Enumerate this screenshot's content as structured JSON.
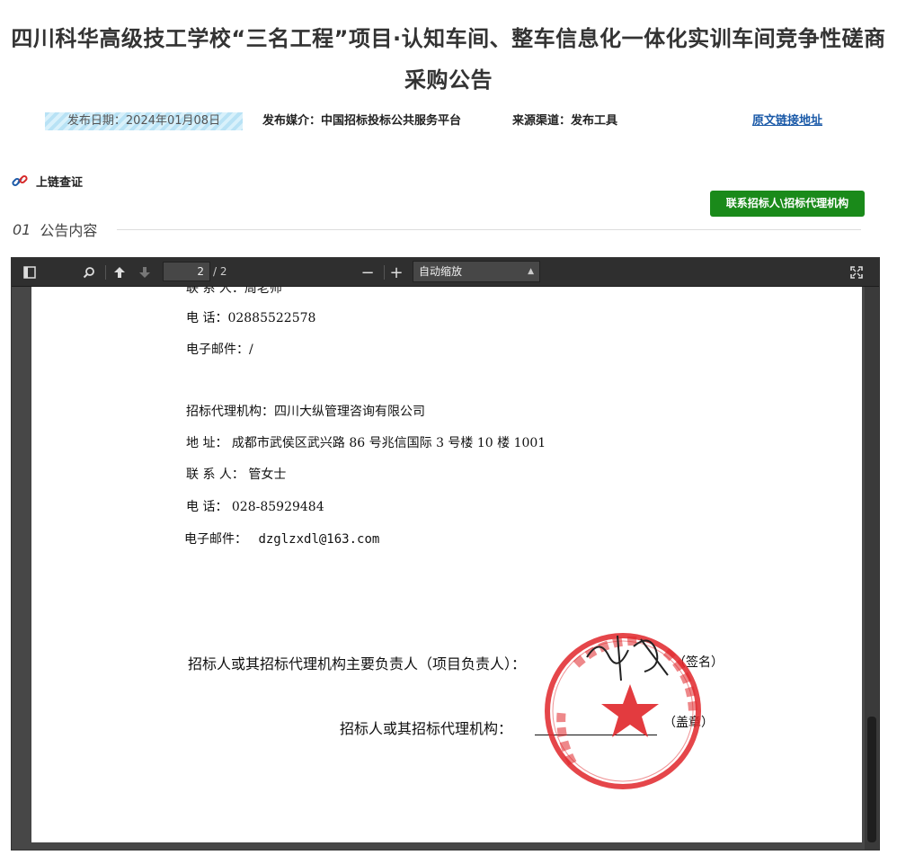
{
  "page": {
    "title_line1": "四川科华高级技工学校“三名工程”项目·认知车间、整车信息化一体化实训车间竞争性磋商",
    "title_line2": "采购公告"
  },
  "meta": {
    "date": "发布日期：2024年01月08日",
    "media": "发布媒介：中国招标投标公共服务平台",
    "source": "来源渠道：发布工具",
    "original_link": "原文链接地址"
  },
  "chain_verify": "上链查证",
  "contact_button": "联系招标人\\招标代理机构",
  "section": {
    "num": "01",
    "label": "公告内容"
  },
  "viewer": {
    "page_value": "2",
    "page_count": "/ 2",
    "zoom_label": "自动缩放",
    "icons": {
      "sidebar": "sidebar-toggle-icon",
      "search": "search-icon",
      "prev": "arrow-up-icon",
      "next": "arrow-down-icon",
      "zoom_out": "minus-icon",
      "zoom_in": "plus-icon",
      "fullscreen": "fullscreen-icon"
    }
  },
  "document": {
    "cut_line": "联 系 人：周老师",
    "tender_phone": "电      话：02885522578",
    "tender_email": "电子邮件：/",
    "agency_name": "招标代理机构：四川大纵管理咨询有限公司",
    "agency_address": "地      址： 成都市武侯区武兴路 86 号兆信国际 3 号楼 10 楼 1001",
    "agency_contact": "联 系 人： 管女士",
    "agency_phone": "电      话： 028-85929484",
    "agency_email_label": "电子邮件：",
    "agency_email": "dzglzxdl@163.com",
    "sign_line1": "招标人或其招标代理机构主要负责人（项目负责人）：",
    "sign_suffix1": "（签名）",
    "sign_line2": "招标人或其招标代理机构：",
    "sign_suffix2": "（盖章）"
  },
  "colors": {
    "link": "#1b5aa8",
    "button_green": "#1a8a1a",
    "seal_red": "#e0262a",
    "toolbar": "#2f2f2f"
  }
}
